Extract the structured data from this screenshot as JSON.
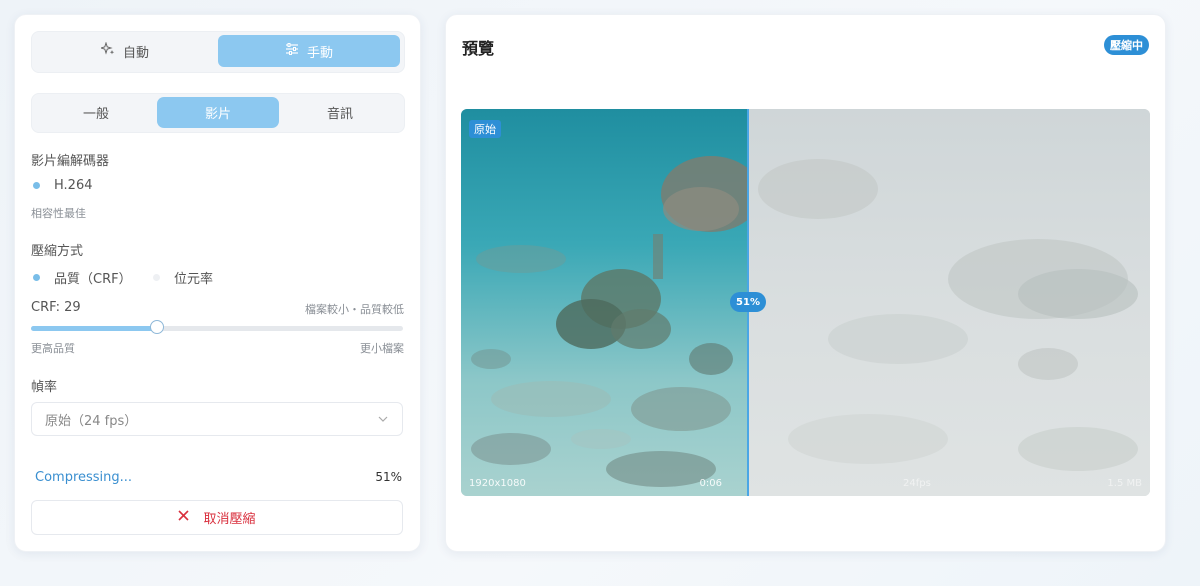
{
  "settings": {
    "mode": {
      "auto_label": "自動",
      "manual_label": "手動"
    },
    "tabs": [
      {
        "label": "一般"
      },
      {
        "label": "影片"
      },
      {
        "label": "音訊"
      }
    ],
    "codec": {
      "heading": "影片編解碼器",
      "option": "H.264",
      "hint": "相容性最佳"
    },
    "compression": {
      "heading": "壓縮方式",
      "option_quality": "品質（CRF）",
      "option_bitrate": "位元率"
    },
    "crf": {
      "label": "CRF: 29",
      "right_hint": "檔案較小・品質較低",
      "value_fraction": 0.34,
      "min_label": "更高品質",
      "max_label": "更小檔案"
    },
    "framerate": {
      "heading": "幀率",
      "selected": "原始（24 fps）"
    },
    "progress": {
      "label": "Compressing...",
      "percent": "51%"
    },
    "cancel_label": "取消壓縮"
  },
  "preview": {
    "title": "預覽",
    "status": "壓縮中",
    "original_badge": "原始",
    "split_percent": "51%",
    "original_resolution": "1920x1080",
    "original_time": "0:06",
    "compressed_res_partial": "24fps",
    "compressed_size_partial": "1.5 MB"
  },
  "colors": {
    "accent": "#8cc8f0",
    "badge_blue": "#2d8fd6",
    "progress_text": "#3a8fd0",
    "cancel_red": "#d9303e"
  }
}
